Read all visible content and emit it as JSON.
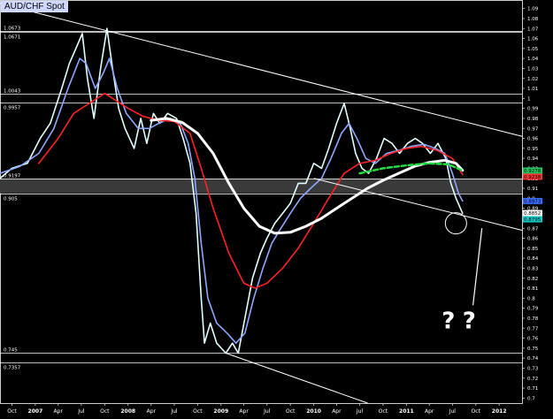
{
  "chart_data": {
    "type": "line",
    "title": "AUD/CHF Spot",
    "y_axis": {
      "ylim": [
        0.695,
        1.095
      ],
      "ticks": [
        "1.09",
        "1.08",
        "1.07",
        "1.06",
        "1.05",
        "1.04",
        "1.03",
        "1.02",
        "1.01",
        "1",
        "0.99",
        "0.98",
        "0.97",
        "0.96",
        "0.95",
        "0.94",
        "0.93",
        "0.92",
        "0.91",
        "0.9",
        "0.89",
        "0.88",
        "0.87",
        "0.86",
        "0.85",
        "0.84",
        "0.83",
        "0.82",
        "0.81",
        "0.8",
        "0.79",
        "0.78",
        "0.77",
        "0.76",
        "0.75",
        "0.74",
        "0.73",
        "0.72",
        "0.71",
        "0.7"
      ],
      "tick_values": [
        1.09,
        1.08,
        1.07,
        1.06,
        1.05,
        1.04,
        1.03,
        1.02,
        1.01,
        1.0,
        0.99,
        0.98,
        0.97,
        0.96,
        0.95,
        0.94,
        0.93,
        0.92,
        0.91,
        0.9,
        0.89,
        0.88,
        0.87,
        0.86,
        0.85,
        0.84,
        0.83,
        0.82,
        0.81,
        0.8,
        0.79,
        0.78,
        0.77,
        0.76,
        0.75,
        0.74,
        0.73,
        0.72,
        0.71,
        0.7
      ]
    },
    "x_axis": {
      "range": [
        "2006-08-15",
        "2012-03-31"
      ],
      "ticks": [
        {
          "label": "Oct",
          "date": "2006-10-01",
          "bold": false
        },
        {
          "label": "2007",
          "date": "2007-01-01",
          "bold": true
        },
        {
          "label": "Apr",
          "date": "2007-04-01",
          "bold": false
        },
        {
          "label": "Jul",
          "date": "2007-07-01",
          "bold": false
        },
        {
          "label": "Oct",
          "date": "2007-10-01",
          "bold": false
        },
        {
          "label": "2008",
          "date": "2008-01-01",
          "bold": true
        },
        {
          "label": "Apr",
          "date": "2008-04-01",
          "bold": false
        },
        {
          "label": "Jul",
          "date": "2008-07-01",
          "bold": false
        },
        {
          "label": "Oct",
          "date": "2008-10-01",
          "bold": false
        },
        {
          "label": "2009",
          "date": "2009-01-01",
          "bold": true
        },
        {
          "label": "Apr",
          "date": "2009-04-01",
          "bold": false
        },
        {
          "label": "Jul",
          "date": "2009-07-01",
          "bold": false
        },
        {
          "label": "Oct",
          "date": "2009-10-01",
          "bold": false
        },
        {
          "label": "2010",
          "date": "2010-01-01",
          "bold": true
        },
        {
          "label": "Apr",
          "date": "2010-04-01",
          "bold": false
        },
        {
          "label": "Jul",
          "date": "2010-07-01",
          "bold": false
        },
        {
          "label": "Oct",
          "date": "2010-10-01",
          "bold": false
        },
        {
          "label": "2011",
          "date": "2011-01-01",
          "bold": true
        },
        {
          "label": "Apr",
          "date": "2011-04-01",
          "bold": false
        },
        {
          "label": "Jul",
          "date": "2011-07-01",
          "bold": false
        },
        {
          "label": "Oct",
          "date": "2011-10-01",
          "bold": false
        },
        {
          "label": "2012",
          "date": "2012-01-01",
          "bold": true
        }
      ]
    },
    "horizontal_levels": [
      {
        "label": "1.0673",
        "value": 1.0673
      },
      {
        "label": "1.0671",
        "value": 1.0671
      },
      {
        "label": "1.0043",
        "value": 1.0043
      },
      {
        "label": "0.9957",
        "value": 0.9957
      },
      {
        "label": "0.9197",
        "value": 0.9197
      },
      {
        "label": "0.905",
        "value": 0.905
      },
      {
        "label": "0.745",
        "value": 0.745
      },
      {
        "label": "0.7357",
        "value": 0.7357
      }
    ],
    "shaded_band": {
      "from": 0.905,
      "to": 0.9197
    },
    "current_labels": [
      {
        "label": "0.9278",
        "value": 0.9278,
        "bg": "#22c55e"
      },
      {
        "label": "0.9238",
        "value": 0.9238,
        "bg": "#ff3333"
      },
      {
        "label": "0.8973",
        "value": 0.8973,
        "bg": "#3b6bff"
      },
      {
        "label": "0.8852",
        "value": 0.8852,
        "bg": "#ffffff"
      },
      {
        "label": "0.8795",
        "value": 0.8795,
        "bg": "#0fc9c9"
      }
    ],
    "series": [
      {
        "color": "#e0ffff",
        "points": [
          [
            "2006-08-15",
            0.92
          ],
          [
            "2006-10-01",
            0.93
          ],
          [
            "2006-12-01",
            0.935
          ],
          [
            "2007-01-20",
            0.96
          ],
          [
            "2007-03-01",
            0.975
          ],
          [
            "2007-04-15",
            1.01
          ],
          [
            "2007-05-15",
            1.035
          ],
          [
            "2007-06-10",
            1.05
          ],
          [
            "2007-07-05",
            1.065
          ],
          [
            "2007-07-25",
            1.02
          ],
          [
            "2007-08-20",
            0.98
          ],
          [
            "2007-09-15",
            1.03
          ],
          [
            "2007-10-10",
            1.07
          ],
          [
            "2007-11-01",
            1.03
          ],
          [
            "2007-11-25",
            0.99
          ],
          [
            "2007-12-20",
            0.97
          ],
          [
            "2008-01-25",
            0.95
          ],
          [
            "2008-02-20",
            0.98
          ],
          [
            "2008-03-15",
            0.955
          ],
          [
            "2008-04-10",
            0.985
          ],
          [
            "2008-05-05",
            0.975
          ],
          [
            "2008-06-05",
            0.985
          ],
          [
            "2008-07-10",
            0.98
          ],
          [
            "2008-08-05",
            0.96
          ],
          [
            "2008-09-01",
            0.935
          ],
          [
            "2008-09-25",
            0.885
          ],
          [
            "2008-10-15",
            0.8
          ],
          [
            "2008-10-28",
            0.755
          ],
          [
            "2008-11-20",
            0.775
          ],
          [
            "2008-12-15",
            0.755
          ],
          [
            "2009-01-20",
            0.745
          ],
          [
            "2009-02-15",
            0.755
          ],
          [
            "2009-03-10",
            0.745
          ],
          [
            "2009-04-05",
            0.78
          ],
          [
            "2009-05-05",
            0.82
          ],
          [
            "2009-06-05",
            0.845
          ],
          [
            "2009-07-01",
            0.86
          ],
          [
            "2009-08-01",
            0.875
          ],
          [
            "2009-09-01",
            0.885
          ],
          [
            "2009-10-01",
            0.895
          ],
          [
            "2009-11-01",
            0.915
          ],
          [
            "2009-12-01",
            0.915
          ],
          [
            "2010-01-01",
            0.935
          ],
          [
            "2010-02-01",
            0.93
          ],
          [
            "2010-03-01",
            0.95
          ],
          [
            "2010-04-01",
            0.975
          ],
          [
            "2010-05-01",
            0.995
          ],
          [
            "2010-05-25",
            0.97
          ],
          [
            "2010-06-15",
            0.945
          ],
          [
            "2010-07-10",
            0.93
          ],
          [
            "2010-08-05",
            0.925
          ],
          [
            "2010-09-05",
            0.94
          ],
          [
            "2010-10-05",
            0.96
          ],
          [
            "2010-11-05",
            0.955
          ],
          [
            "2010-12-05",
            0.945
          ],
          [
            "2011-01-05",
            0.955
          ],
          [
            "2011-02-05",
            0.96
          ],
          [
            "2011-03-05",
            0.955
          ],
          [
            "2011-04-05",
            0.945
          ],
          [
            "2011-05-05",
            0.955
          ],
          [
            "2011-06-05",
            0.94
          ],
          [
            "2011-06-25",
            0.915
          ],
          [
            "2011-07-15",
            0.9
          ],
          [
            "2011-08-10",
            0.885
          ]
        ]
      },
      {
        "color": "#8fa8ff",
        "points": [
          [
            "2006-08-15",
            0.925
          ],
          [
            "2006-11-01",
            0.932
          ],
          [
            "2007-01-15",
            0.945
          ],
          [
            "2007-03-15",
            0.97
          ],
          [
            "2007-05-10",
            1.01
          ],
          [
            "2007-06-25",
            1.04
          ],
          [
            "2007-07-20",
            1.035
          ],
          [
            "2007-08-25",
            1.01
          ],
          [
            "2007-09-25",
            1.025
          ],
          [
            "2007-10-20",
            1.04
          ],
          [
            "2007-11-20",
            1.01
          ],
          [
            "2007-12-25",
            0.985
          ],
          [
            "2008-02-10",
            0.97
          ],
          [
            "2008-03-25",
            0.97
          ],
          [
            "2008-05-01",
            0.975
          ],
          [
            "2008-06-15",
            0.98
          ],
          [
            "2008-07-25",
            0.975
          ],
          [
            "2008-08-25",
            0.955
          ],
          [
            "2008-09-20",
            0.92
          ],
          [
            "2008-10-15",
            0.855
          ],
          [
            "2008-11-10",
            0.8
          ],
          [
            "2008-12-15",
            0.775
          ],
          [
            "2009-01-25",
            0.765
          ],
          [
            "2009-03-01",
            0.755
          ],
          [
            "2009-04-05",
            0.765
          ],
          [
            "2009-05-10",
            0.8
          ],
          [
            "2009-06-15",
            0.83
          ],
          [
            "2009-07-20",
            0.855
          ],
          [
            "2009-08-25",
            0.87
          ],
          [
            "2009-10-01",
            0.885
          ],
          [
            "2009-11-10",
            0.9
          ],
          [
            "2009-12-20",
            0.91
          ],
          [
            "2010-02-01",
            0.92
          ],
          [
            "2010-03-10",
            0.94
          ],
          [
            "2010-04-20",
            0.965
          ],
          [
            "2010-05-20",
            0.975
          ],
          [
            "2010-06-20",
            0.96
          ],
          [
            "2010-07-25",
            0.94
          ],
          [
            "2010-09-01",
            0.935
          ],
          [
            "2010-10-15",
            0.945
          ],
          [
            "2010-12-01",
            0.948
          ],
          [
            "2011-01-20",
            0.952
          ],
          [
            "2011-03-10",
            0.954
          ],
          [
            "2011-04-25",
            0.95
          ],
          [
            "2011-06-01",
            0.945
          ],
          [
            "2011-07-01",
            0.925
          ],
          [
            "2011-07-25",
            0.905
          ],
          [
            "2011-08-10",
            0.8973
          ]
        ]
      },
      {
        "color": "#ff2222",
        "points": [
          [
            "2007-01-15",
            0.935
          ],
          [
            "2007-04-01",
            0.96
          ],
          [
            "2007-06-01",
            0.985
          ],
          [
            "2007-08-01",
            0.995
          ],
          [
            "2007-10-01",
            1.005
          ],
          [
            "2007-11-01",
            1.0
          ],
          [
            "2008-01-01",
            0.99
          ],
          [
            "2008-03-01",
            0.982
          ],
          [
            "2008-05-01",
            0.978
          ],
          [
            "2008-07-01",
            0.977
          ],
          [
            "2008-09-01",
            0.965
          ],
          [
            "2008-10-15",
            0.93
          ],
          [
            "2008-12-01",
            0.89
          ],
          [
            "2009-02-01",
            0.845
          ],
          [
            "2009-04-01",
            0.815
          ],
          [
            "2009-05-15",
            0.81
          ],
          [
            "2009-07-01",
            0.815
          ],
          [
            "2009-09-01",
            0.83
          ],
          [
            "2009-11-01",
            0.85
          ],
          [
            "2010-01-01",
            0.875
          ],
          [
            "2010-03-01",
            0.9
          ],
          [
            "2010-05-01",
            0.925
          ],
          [
            "2010-07-01",
            0.935
          ],
          [
            "2010-09-01",
            0.938
          ],
          [
            "2010-11-01",
            0.945
          ],
          [
            "2011-01-01",
            0.95
          ],
          [
            "2011-03-01",
            0.952
          ],
          [
            "2011-05-01",
            0.948
          ],
          [
            "2011-07-01",
            0.94
          ],
          [
            "2011-08-10",
            0.9238
          ]
        ]
      },
      {
        "color": "#ffffff",
        "width": 3,
        "points": [
          [
            "2008-04-01",
            0.978
          ],
          [
            "2008-06-01",
            0.98
          ],
          [
            "2008-08-01",
            0.976
          ],
          [
            "2008-10-01",
            0.965
          ],
          [
            "2008-12-01",
            0.945
          ],
          [
            "2009-02-01",
            0.915
          ],
          [
            "2009-04-01",
            0.89
          ],
          [
            "2009-06-01",
            0.872
          ],
          [
            "2009-08-01",
            0.865
          ],
          [
            "2009-10-01",
            0.866
          ],
          [
            "2009-12-01",
            0.872
          ],
          [
            "2010-02-01",
            0.88
          ],
          [
            "2010-04-01",
            0.89
          ],
          [
            "2010-06-01",
            0.9
          ],
          [
            "2010-08-01",
            0.91
          ],
          [
            "2010-10-01",
            0.918
          ],
          [
            "2010-12-01",
            0.925
          ],
          [
            "2011-02-01",
            0.932
          ],
          [
            "2011-04-01",
            0.936
          ],
          [
            "2011-06-01",
            0.938
          ],
          [
            "2011-07-15",
            0.935
          ],
          [
            "2011-08-10",
            0.928
          ]
        ]
      },
      {
        "color": "#22dd44",
        "width": 2.5,
        "dashed": true,
        "points": [
          [
            "2010-07-01",
            0.925
          ],
          [
            "2010-10-01",
            0.93
          ],
          [
            "2011-01-01",
            0.933
          ],
          [
            "2011-04-01",
            0.935
          ],
          [
            "2011-06-15",
            0.934
          ],
          [
            "2011-08-10",
            0.9278
          ]
        ]
      }
    ],
    "trendlines": [
      {
        "from": [
          "2006-08-15",
          1.095
        ],
        "to": [
          "2012-03-31",
          0.962
        ]
      },
      {
        "from": [
          "2010-01-01",
          0.92
        ],
        "to": [
          "2012-03-31",
          0.868
        ]
      },
      {
        "from": [
          "2009-01-20",
          0.745
        ],
        "to": [
          "2010-08-01",
          0.695
        ]
      }
    ],
    "annotations": {
      "arrow": {
        "from": [
          "2011-09-20",
          0.793
        ],
        "to": [
          "2011-10-25",
          0.87
        ]
      },
      "question_marks": [
        {
          "text": "?",
          "date": "2011-06-15",
          "value": 0.77
        },
        {
          "text": "?",
          "date": "2011-09-05",
          "value": 0.77
        }
      ],
      "circle": {
        "date": "2011-07-15",
        "value": 0.875
      }
    }
  }
}
